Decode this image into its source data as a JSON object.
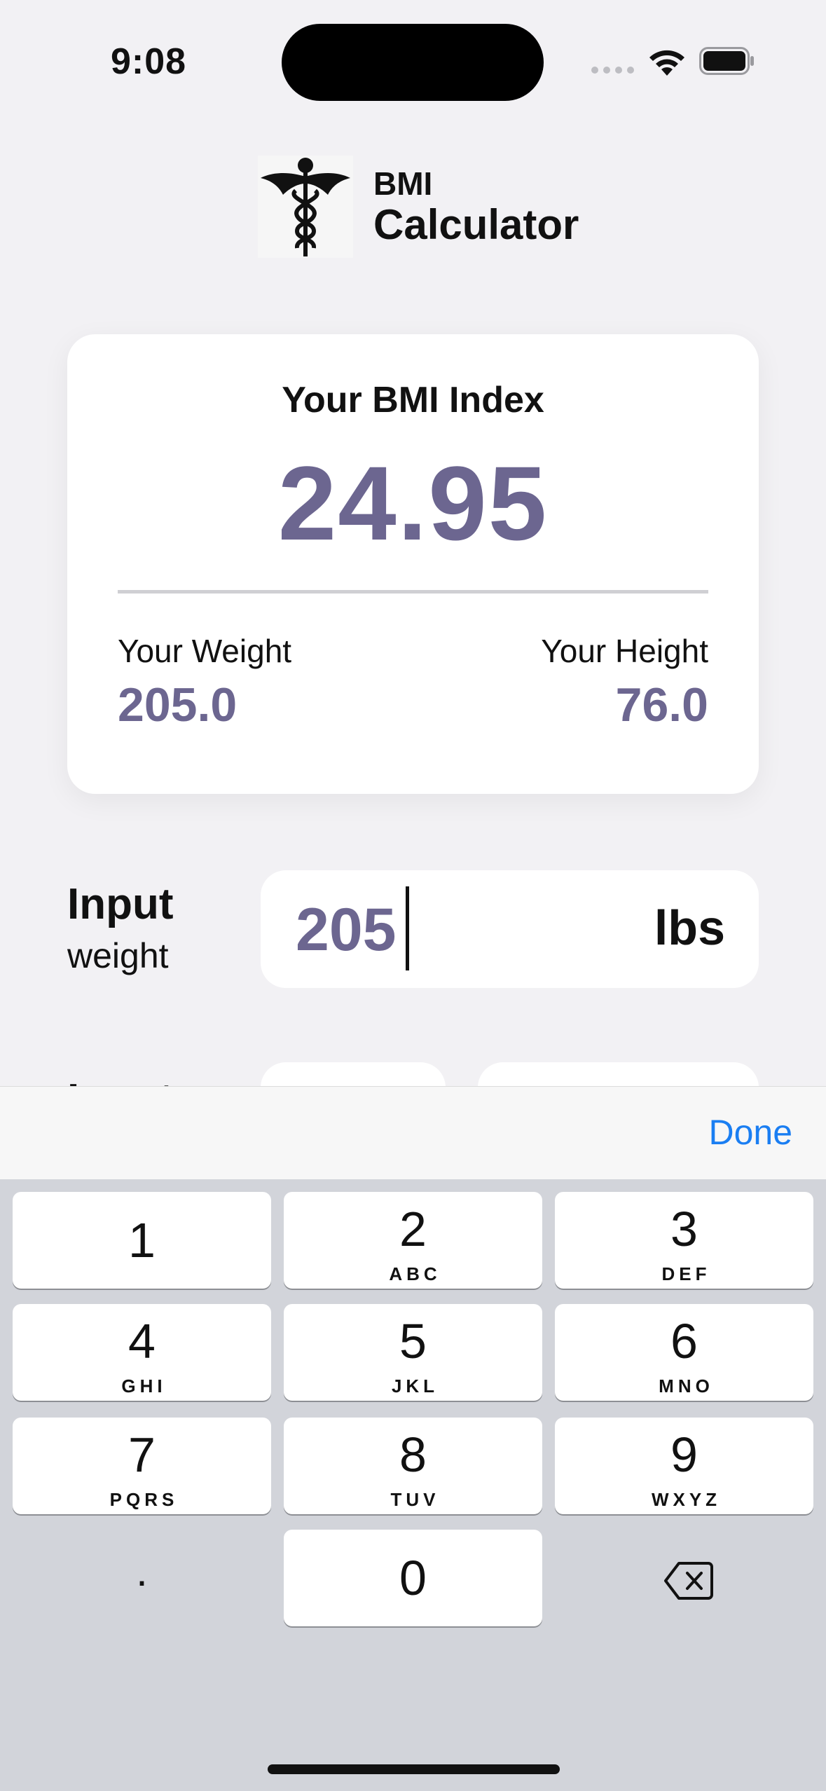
{
  "status_bar": {
    "time": "9:08"
  },
  "header": {
    "title_line1": "BMI",
    "title_line2": "Calculator",
    "logo_icon": "caduceus-icon"
  },
  "result_card": {
    "title": "Your BMI Index",
    "bmi": "24.95",
    "weight_label": "Your Weight",
    "weight_value": "205.0",
    "height_label": "Your Height",
    "height_value": "76.0"
  },
  "weight_input": {
    "label": "Input",
    "sublabel": "weight",
    "value": "205",
    "unit": "lbs"
  },
  "next_input": {
    "label": "Input"
  },
  "keyboard_toolbar": {
    "done_label": "Done"
  },
  "keypad": {
    "keys": [
      {
        "num": "1",
        "letters": ""
      },
      {
        "num": "2",
        "letters": "ABC"
      },
      {
        "num": "3",
        "letters": "DEF"
      },
      {
        "num": "4",
        "letters": "GHI"
      },
      {
        "num": "5",
        "letters": "JKL"
      },
      {
        "num": "6",
        "letters": "MNO"
      },
      {
        "num": "7",
        "letters": "PQRS"
      },
      {
        "num": "8",
        "letters": "TUV"
      },
      {
        "num": "9",
        "letters": "WXYZ"
      },
      {
        "num": "0",
        "letters": ""
      }
    ],
    "decimal": ".",
    "delete_icon": "delete-backspace-icon"
  },
  "colors": {
    "accent": "#6c6690",
    "link_blue": "#1a7ef2",
    "background": "#f2f1f4",
    "keyboard_bg": "#d2d4da"
  }
}
